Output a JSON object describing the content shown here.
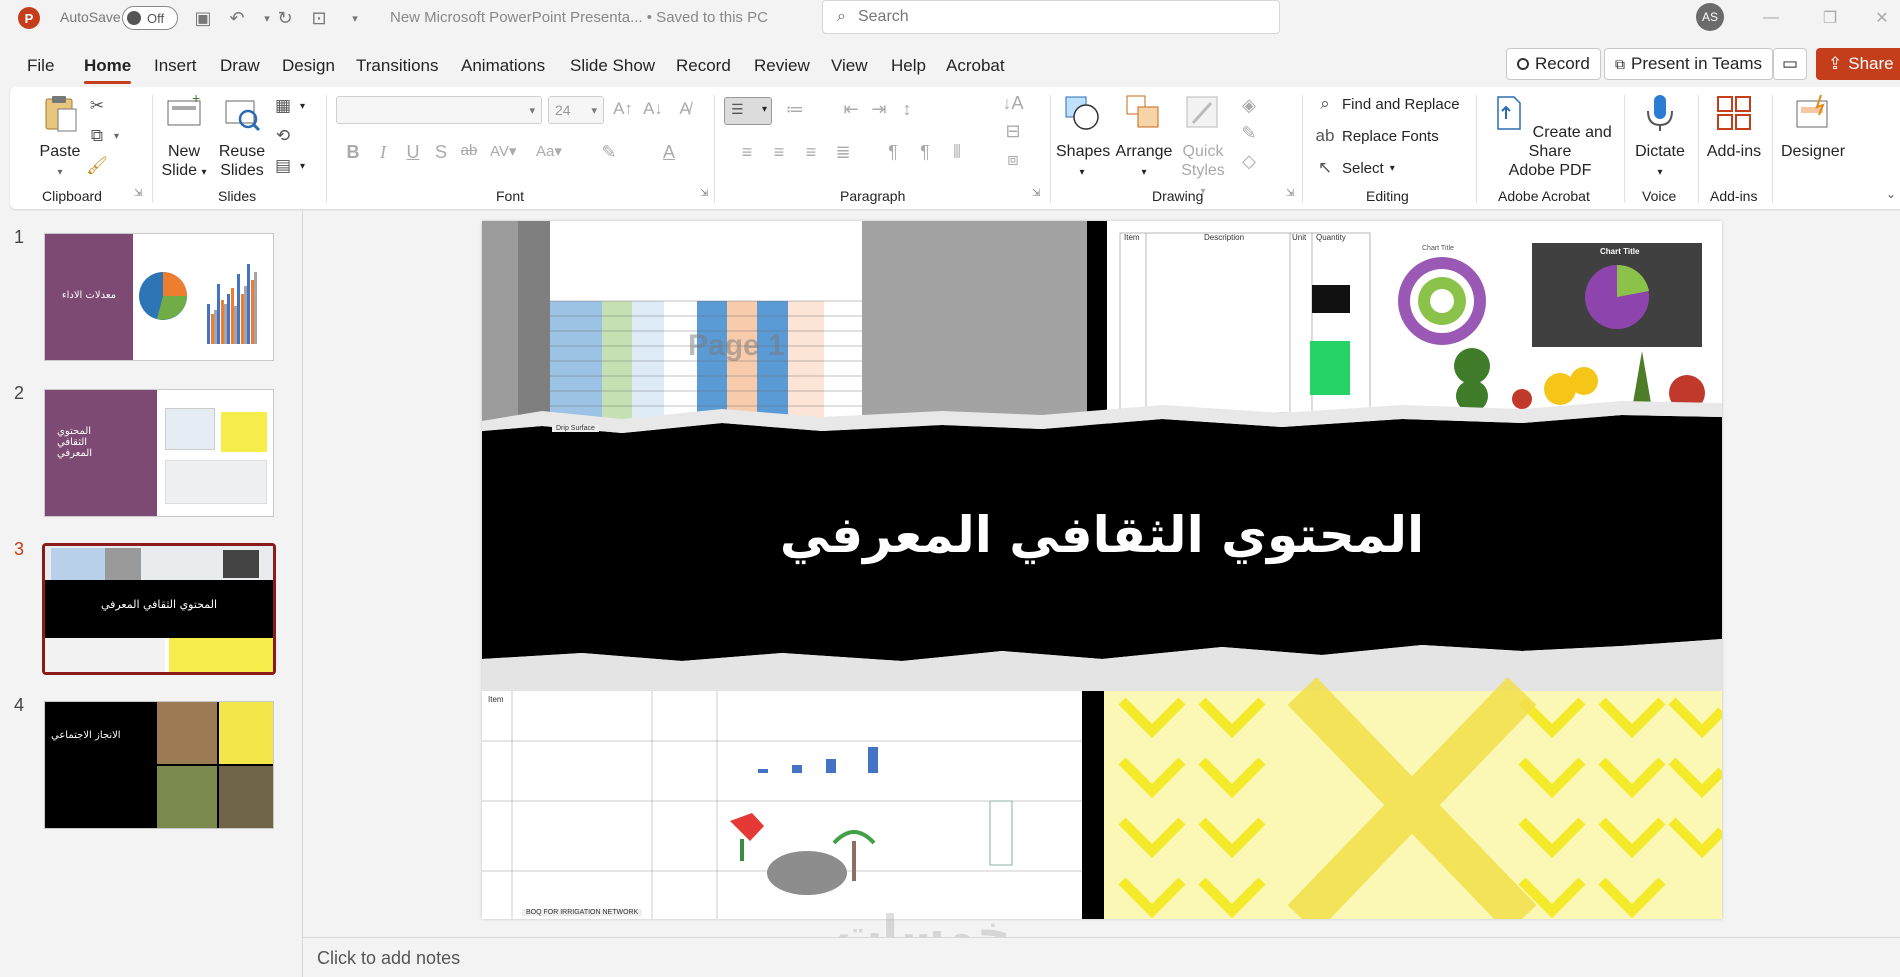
{
  "titlebar": {
    "autosave_label": "AutoSave",
    "autosave_state": "Off",
    "doc_title": "New Microsoft PowerPoint Presenta...  •  Saved to this PC",
    "search_placeholder": "Search",
    "avatar_initials": "AS"
  },
  "tabs": [
    "File",
    "Home",
    "Insert",
    "Draw",
    "Design",
    "Transitions",
    "Animations",
    "Slide Show",
    "Record",
    "Review",
    "View",
    "Help",
    "Acrobat"
  ],
  "active_tab": "Home",
  "top_buttons": {
    "record": "Record",
    "present_teams": "Present in Teams",
    "share": "Share"
  },
  "ribbon": {
    "clipboard": {
      "paste": "Paste",
      "label": "Clipboard"
    },
    "slides": {
      "new_slide_1": "New",
      "new_slide_2": "Slide",
      "reuse_1": "Reuse",
      "reuse_2": "Slides",
      "label": "Slides"
    },
    "font": {
      "font_name": "",
      "font_size": "24",
      "label": "Font"
    },
    "paragraph": {
      "label": "Paragraph"
    },
    "drawing": {
      "shapes": "Shapes",
      "arrange": "Arrange",
      "quick_styles_1": "Quick",
      "quick_styles_2": "Styles",
      "label": "Drawing"
    },
    "editing": {
      "find_replace": "Find and Replace",
      "replace_fonts": "Replace Fonts",
      "select": "Select",
      "label": "Editing"
    },
    "acrobat": {
      "create_1": "Create and Share",
      "create_2": "Adobe PDF",
      "label": "Adobe Acrobat"
    },
    "voice": {
      "dictate": "Dictate",
      "label": "Voice"
    },
    "addins": {
      "addins": "Add-ins",
      "label": "Add-ins"
    },
    "designer": {
      "designer": "Designer"
    }
  },
  "slides": [
    {
      "num": "1",
      "title": "معدلات الاداء"
    },
    {
      "num": "2",
      "title": "المحتوي الثقافي المعرفي"
    },
    {
      "num": "3",
      "title": "المحتوي الثقافي المعرفي"
    },
    {
      "num": "4",
      "title": "الانجاز الاجتماعي"
    }
  ],
  "selected_slide": "3",
  "main_slide": {
    "title": "المحتوي الثقافي المعرفي",
    "page_watermark": "Page 1",
    "sheet_tab": "Drip Surface",
    "sheet_tab_2": "BOQ FOR IRRIGATION NETWORK",
    "chart_title": "Chart Title",
    "table_headers": [
      "Item",
      "Description",
      "Unit",
      "Quantity"
    ]
  },
  "notes": {
    "placeholder": "Click to add notes"
  },
  "watermark": "خمسات",
  "colors": {
    "accent": "#c43e1c",
    "slide_bg_black": "#000000",
    "yellow": "#f4ea2a",
    "purple": "#7d4a73"
  }
}
